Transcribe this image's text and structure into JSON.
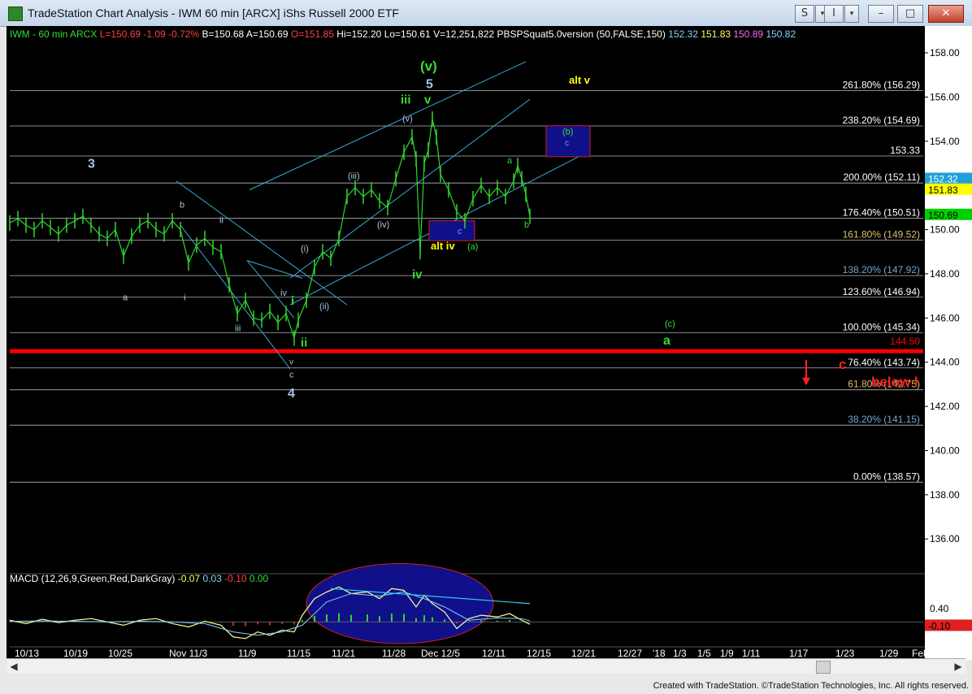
{
  "window": {
    "title": "TradeStation Chart Analysis - IWM 60 min [ARCX] iShs Russell 2000 ETF",
    "controls": [
      "S",
      "I",
      "–",
      "□",
      "✕"
    ]
  },
  "header": {
    "symbol_line": "IWM - 60 min  ARCX",
    "stats": [
      {
        "text": "L=150.69",
        "color": "#ff4040"
      },
      {
        "text": "-1.09",
        "color": "#ff4040"
      },
      {
        "text": "-0.72%",
        "color": "#ff4040"
      },
      {
        "text": "B=150.68",
        "color": "#ffffff"
      },
      {
        "text": "A=150.69",
        "color": "#ffffff"
      },
      {
        "text": "O=151.85",
        "color": "#ff4040"
      },
      {
        "text": "Hi=152.20",
        "color": "#ffffff"
      },
      {
        "text": "Lo=150.61",
        "color": "#ffffff"
      },
      {
        "text": "V=12,251,822",
        "color": "#ffffff"
      },
      {
        "text": "PBSPSquat5.0version (50,FALSE,150)",
        "color": "#ffffff"
      },
      {
        "text": "152.32",
        "color": "#7fd4ff"
      },
      {
        "text": "151.83",
        "color": "#ffff66"
      },
      {
        "text": "150.89",
        "color": "#ff66ff"
      },
      {
        "text": "150.82",
        "color": "#7fd4ff"
      }
    ]
  },
  "chart_data": {
    "type": "line",
    "title": "IWM - 60 min ARCX",
    "x_tick_labels": [
      "10/13",
      "10/19",
      "10/25",
      "Nov 11/3",
      "11/9",
      "11/15",
      "11/21",
      "11/28",
      "Dec 12/5",
      "12/11",
      "12/15",
      "12/21",
      "12/27",
      "'18",
      "1/3",
      "1/5",
      "1/9",
      "1/11",
      "1/17",
      "1/23",
      "1/29",
      "Feb"
    ],
    "y_ticks": [
      136,
      138,
      140,
      142,
      144,
      146,
      148,
      150,
      152,
      154,
      156,
      158
    ],
    "y_tick_labels": [
      "136.00",
      "138.00",
      "140.00",
      "142.00",
      "144.00",
      "146.00",
      "148.00",
      "150.00",
      "152.00",
      "154.00",
      "156.00",
      "158.00"
    ],
    "ylim": [
      134.5,
      158.7
    ],
    "price_series": [
      [
        0,
        150.3
      ],
      [
        10,
        150.5
      ],
      [
        20,
        150.2
      ],
      [
        30,
        150.0
      ],
      [
        40,
        150.4
      ],
      [
        50,
        150.1
      ],
      [
        60,
        149.8
      ],
      [
        70,
        150.2
      ],
      [
        80,
        150.4
      ],
      [
        90,
        150.6
      ],
      [
        100,
        150.2
      ],
      [
        110,
        149.8
      ],
      [
        120,
        149.6
      ],
      [
        130,
        150.0
      ],
      [
        140,
        148.8
      ],
      [
        150,
        149.7
      ],
      [
        160,
        150.2
      ],
      [
        170,
        150.4
      ],
      [
        180,
        150.0
      ],
      [
        190,
        149.8
      ],
      [
        200,
        150.4
      ],
      [
        210,
        150.0
      ],
      [
        220,
        148.5
      ],
      [
        230,
        149.3
      ],
      [
        240,
        149.6
      ],
      [
        250,
        149.2
      ],
      [
        260,
        149.0
      ],
      [
        270,
        147.5
      ],
      [
        280,
        146.2
      ],
      [
        290,
        146.8
      ],
      [
        300,
        146.0
      ],
      [
        310,
        145.9
      ],
      [
        320,
        146.3
      ],
      [
        330,
        145.8
      ],
      [
        340,
        146.2
      ],
      [
        350,
        145.1
      ],
      [
        355,
        145.9
      ],
      [
        365,
        146.8
      ],
      [
        375,
        148.3
      ],
      [
        385,
        149.0
      ],
      [
        395,
        148.7
      ],
      [
        405,
        149.6
      ],
      [
        415,
        151.5
      ],
      [
        425,
        151.9
      ],
      [
        435,
        151.5
      ],
      [
        445,
        151.8
      ],
      [
        455,
        151.3
      ],
      [
        465,
        151.0
      ],
      [
        475,
        152.3
      ],
      [
        485,
        153.5
      ],
      [
        495,
        154.2
      ],
      [
        500,
        153.2
      ],
      [
        505,
        149.0
      ],
      [
        510,
        153.0
      ],
      [
        515,
        153.6
      ],
      [
        520,
        155.0
      ],
      [
        525,
        154.2
      ],
      [
        530,
        152.5
      ],
      [
        540,
        151.8
      ],
      [
        550,
        150.8
      ],
      [
        560,
        150.4
      ],
      [
        570,
        151.4
      ],
      [
        580,
        152.0
      ],
      [
        590,
        151.5
      ],
      [
        600,
        151.9
      ],
      [
        610,
        151.5
      ],
      [
        620,
        152.2
      ],
      [
        625,
        152.9
      ],
      [
        630,
        152.3
      ],
      [
        635,
        151.6
      ],
      [
        640,
        150.6
      ]
    ],
    "fib_levels": [
      {
        "label": "261.80% (156.29)",
        "value": 156.29,
        "color": "#ffffff"
      },
      {
        "label": "238.20% (154.69)",
        "value": 154.69,
        "color": "#ffffff"
      },
      {
        "label": "153.33",
        "value": 153.33,
        "color": "#ffffff"
      },
      {
        "label": "200.00% (152.11)",
        "value": 152.11,
        "color": "#ffffff"
      },
      {
        "label": "176.40% (150.51)",
        "value": 150.51,
        "color": "#ffffff"
      },
      {
        "label": "161.80% (149.52)",
        "value": 149.52,
        "color": "#d9c36a"
      },
      {
        "label": "138.20% (147.92)",
        "value": 147.92,
        "color": "#6fa7d4"
      },
      {
        "label": "123.60% (146.94)",
        "value": 146.94,
        "color": "#ffffff"
      },
      {
        "label": "100.00% (145.34)",
        "value": 145.34,
        "color": "#ffffff"
      },
      {
        "label": "76.40% (143.74)",
        "value": 143.74,
        "color": "#ffffff"
      },
      {
        "label": "61.80% (142.75)",
        "value": 142.75,
        "color": "#d9c36a"
      },
      {
        "label": "38.20% (141.15)",
        "value": 141.15,
        "color": "#6fa7d4"
      },
      {
        "label": "0.00% (138.57)",
        "value": 138.57,
        "color": "#ffffff"
      }
    ],
    "support_line": {
      "label": "144.50",
      "value": 144.5,
      "color": "#ff0000"
    },
    "price_boxes": [
      {
        "label": "152.32",
        "value": 152.32,
        "bg": "#1fa0d8",
        "fg": "#ffffff"
      },
      {
        "label": "151.83",
        "value": 151.83,
        "bg": "#ffff00",
        "fg": "#000000"
      },
      {
        "label": "150.69",
        "value": 150.69,
        "bg": "#00d000",
        "fg": "#000000"
      }
    ],
    "wave_labels": [
      {
        "text": "3",
        "x": 96,
        "y": 152.8,
        "color": "#a9c3e0",
        "size": 16,
        "bold": true
      },
      {
        "text": "b",
        "x": 209,
        "y": 151.0,
        "color": "#a9c3e0",
        "size": 11
      },
      {
        "text": "ii",
        "x": 258,
        "y": 150.3,
        "color": "#a9c3e0",
        "size": 11
      },
      {
        "text": "a",
        "x": 139,
        "y": 146.8,
        "color": "#a9c3e0",
        "size": 11
      },
      {
        "text": "i",
        "x": 214,
        "y": 146.8,
        "color": "#a9c3e0",
        "size": 11
      },
      {
        "text": "iii",
        "x": 277,
        "y": 145.4,
        "color": "#a9c3e0",
        "size": 11
      },
      {
        "text": "iv",
        "x": 333,
        "y": 147.0,
        "color": "#a9c3e0",
        "size": 11
      },
      {
        "text": "v",
        "x": 344,
        "y": 143.9,
        "color": "#a9c3e0",
        "size": 10
      },
      {
        "text": "c",
        "x": 344,
        "y": 143.3,
        "color": "#a9c3e0",
        "size": 11
      },
      {
        "text": "4",
        "x": 342,
        "y": 142.4,
        "color": "#a9c3e0",
        "size": 16,
        "bold": true
      },
      {
        "text": "i",
        "x": 346,
        "y": 146.6,
        "color": "#33dd33",
        "size": 15,
        "bold": true
      },
      {
        "text": "ii",
        "x": 358,
        "y": 144.7,
        "color": "#33dd33",
        "size": 15,
        "bold": true
      },
      {
        "text": "(i)",
        "x": 358,
        "y": 149.0,
        "color": "#a9c3e0",
        "size": 11
      },
      {
        "text": "(ii)",
        "x": 381,
        "y": 146.4,
        "color": "#a9c3e0",
        "size": 11
      },
      {
        "text": "(iii)",
        "x": 416,
        "y": 152.3,
        "color": "#a9c3e0",
        "size": 11
      },
      {
        "text": "(iv)",
        "x": 452,
        "y": 150.1,
        "color": "#a9c3e0",
        "size": 11
      },
      {
        "text": "(v)",
        "x": 483,
        "y": 154.9,
        "color": "#a9c3e0",
        "size": 11
      },
      {
        "text": "iii",
        "x": 481,
        "y": 155.7,
        "color": "#33dd33",
        "size": 15,
        "bold": true
      },
      {
        "text": "iv",
        "x": 495,
        "y": 147.8,
        "color": "#33dd33",
        "size": 15,
        "bold": true
      },
      {
        "text": "v",
        "x": 510,
        "y": 155.7,
        "color": "#33dd33",
        "size": 15,
        "bold": true
      },
      {
        "text": "5",
        "x": 512,
        "y": 156.4,
        "color": "#a9c3e0",
        "size": 16,
        "bold": true
      },
      {
        "text": "(v)",
        "x": 505,
        "y": 157.2,
        "color": "#33dd33",
        "size": 17,
        "bold": true
      },
      {
        "text": "alt iv",
        "x": 518,
        "y": 149.1,
        "color": "#ffff00",
        "size": 13,
        "bold": true
      },
      {
        "text": "(a)",
        "x": 563,
        "y": 149.1,
        "color": "#33dd33",
        "size": 11
      },
      {
        "text": "c",
        "x": 551,
        "y": 149.8,
        "color": "#6fa7d4",
        "size": 11
      },
      {
        "text": "a",
        "x": 612,
        "y": 153.0,
        "color": "#33dd33",
        "size": 11
      },
      {
        "text": "b",
        "x": 633,
        "y": 150.1,
        "color": "#33dd33",
        "size": 11
      },
      {
        "text": "(b)",
        "x": 680,
        "y": 154.3,
        "color": "#33dd33",
        "size": 11
      },
      {
        "text": "c",
        "x": 683,
        "y": 153.8,
        "color": "#6fa7d4",
        "size": 10
      },
      {
        "text": "alt v",
        "x": 688,
        "y": 156.6,
        "color": "#ffff00",
        "size": 13,
        "bold": true
      },
      {
        "text": "(c)",
        "x": 806,
        "y": 145.6,
        "color": "#33dd33",
        "size": 11
      },
      {
        "text": "a",
        "x": 804,
        "y": 144.8,
        "color": "#33dd33",
        "size": 16,
        "bold": true
      },
      {
        "text": "c",
        "x": 1020,
        "y": 143.7,
        "color": "#ff2020",
        "size": 17,
        "bold": true
      },
      {
        "text": "below l",
        "x": 1060,
        "y": 142.9,
        "color": "#ff2020",
        "size": 17,
        "bold": true
      }
    ],
    "macd": {
      "title": "MACD (12,26,9,Green,Red,DarkGray)",
      "values": [
        {
          "text": "-0.07",
          "color": "#ffff66"
        },
        {
          "text": "0.03",
          "color": "#7fd4ff"
        },
        {
          "text": "-0.10",
          "color": "#ff4040"
        },
        {
          "text": "0.00",
          "color": "#33dd33"
        }
      ],
      "tick_label": "0.40",
      "tick_value": 0.4,
      "current_label": "-0.10",
      "current_value": -0.1,
      "ylim": [
        -0.7,
        1.3
      ],
      "macd_line": [
        [
          0,
          0.05
        ],
        [
          20,
          -0.05
        ],
        [
          40,
          0.08
        ],
        [
          60,
          -0.02
        ],
        [
          80,
          0.05
        ],
        [
          100,
          0.1
        ],
        [
          120,
          0.0
        ],
        [
          140,
          -0.1
        ],
        [
          160,
          0.05
        ],
        [
          180,
          0.1
        ],
        [
          200,
          -0.05
        ],
        [
          220,
          -0.15
        ],
        [
          240,
          0.02
        ],
        [
          260,
          -0.1
        ],
        [
          275,
          -0.45
        ],
        [
          290,
          -0.5
        ],
        [
          305,
          -0.3
        ],
        [
          320,
          -0.4
        ],
        [
          335,
          -0.25
        ],
        [
          350,
          -0.3
        ],
        [
          360,
          0.2
        ],
        [
          375,
          0.7
        ],
        [
          390,
          0.9
        ],
        [
          405,
          1.05
        ],
        [
          420,
          0.85
        ],
        [
          440,
          0.9
        ],
        [
          455,
          0.7
        ],
        [
          470,
          1.0
        ],
        [
          485,
          0.95
        ],
        [
          500,
          0.45
        ],
        [
          510,
          0.8
        ],
        [
          520,
          0.55
        ],
        [
          535,
          0.3
        ],
        [
          550,
          -0.2
        ],
        [
          565,
          0.1
        ],
        [
          580,
          0.2
        ],
        [
          600,
          0.15
        ],
        [
          615,
          0.25
        ],
        [
          630,
          0.05
        ],
        [
          640,
          -0.07
        ]
      ],
      "signal_line": [
        [
          0,
          0.02
        ],
        [
          40,
          0.03
        ],
        [
          80,
          0.02
        ],
        [
          120,
          0.0
        ],
        [
          160,
          0.02
        ],
        [
          200,
          0.0
        ],
        [
          240,
          -0.05
        ],
        [
          275,
          -0.3
        ],
        [
          305,
          -0.4
        ],
        [
          335,
          -0.3
        ],
        [
          360,
          -0.1
        ],
        [
          390,
          0.6
        ],
        [
          420,
          0.85
        ],
        [
          455,
          0.78
        ],
        [
          485,
          0.9
        ],
        [
          510,
          0.7
        ],
        [
          535,
          0.45
        ],
        [
          565,
          0.05
        ],
        [
          600,
          0.12
        ],
        [
          630,
          0.1
        ],
        [
          640,
          0.03
        ]
      ],
      "divergence_line": [
        [
          395,
          1.0
        ],
        [
          640,
          0.55
        ]
      ]
    }
  },
  "footer": {
    "credit": "Created with TradeStation. ©TradeStation Technologies, Inc. All rights reserved."
  }
}
